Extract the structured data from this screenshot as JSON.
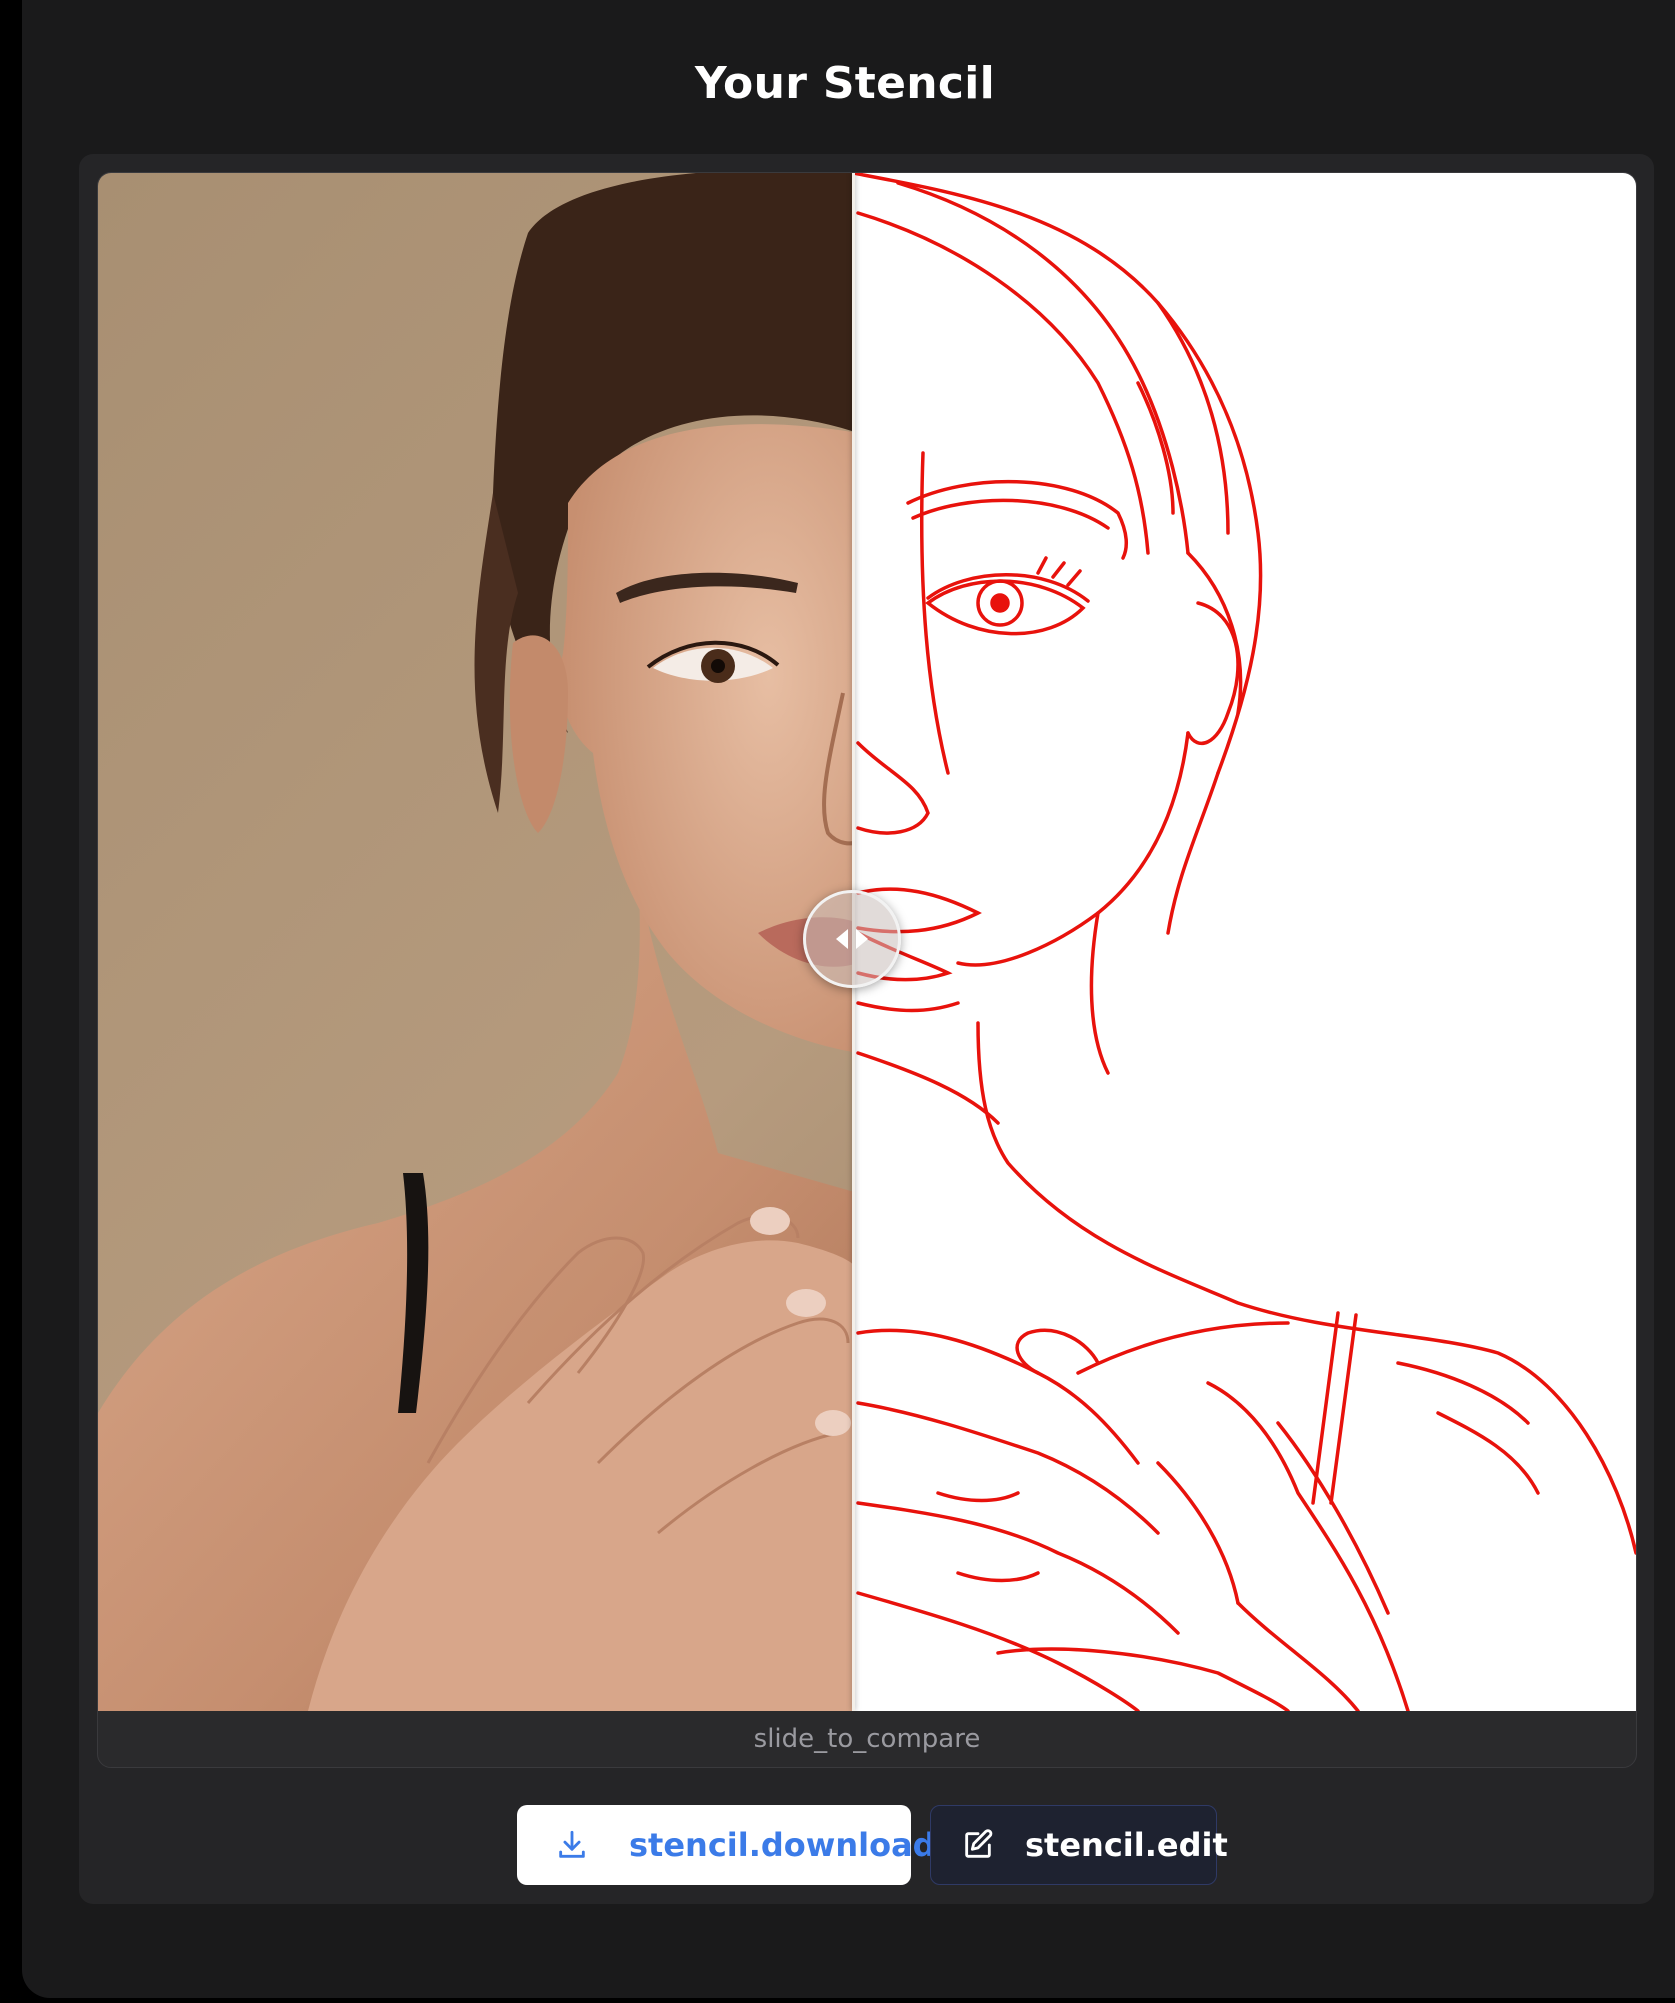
{
  "page": {
    "title": "Your Stencil"
  },
  "compare": {
    "caption": "slide_to_compare",
    "slider_position": 0.49
  },
  "actions": {
    "download_label": "stencil.download",
    "download_icon": "download-icon",
    "edit_label": "stencil.edit",
    "edit_icon": "edit-icon"
  },
  "colors": {
    "background": "#1a1a1b",
    "panel": "#252527",
    "stencil_line": "#e8120c",
    "download_text": "#3b7be8",
    "edit_bg": "#1e2230"
  }
}
